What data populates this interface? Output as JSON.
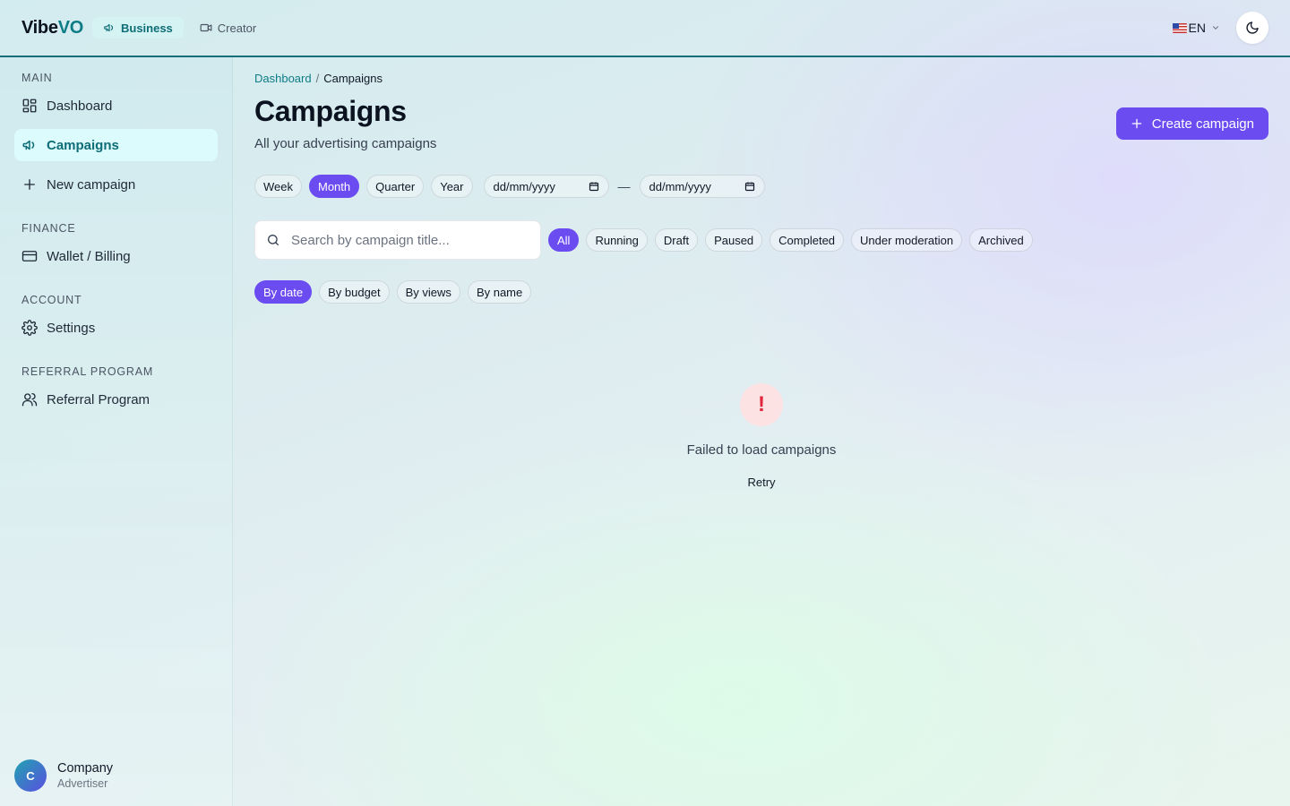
{
  "header": {
    "logo_main": "Vibe",
    "logo_accent": "VO",
    "modes": [
      {
        "label": "Business",
        "icon": "megaphone-icon",
        "active": true
      },
      {
        "label": "Creator",
        "icon": "video-icon",
        "active": false
      }
    ],
    "language": "EN",
    "theme_icon": "moon-icon"
  },
  "sidebar": {
    "sections": [
      {
        "label": "MAIN",
        "items": [
          {
            "label": "Dashboard",
            "icon": "grid-icon"
          },
          {
            "label": "Campaigns",
            "icon": "megaphone-icon",
            "active": true
          },
          {
            "label": "New campaign",
            "icon": "plus-icon"
          }
        ]
      },
      {
        "label": "FINANCE",
        "items": [
          {
            "label": "Wallet / Billing",
            "icon": "card-icon"
          }
        ]
      },
      {
        "label": "ACCOUNT",
        "items": [
          {
            "label": "Settings",
            "icon": "gear-icon"
          }
        ]
      },
      {
        "label": "REFERRAL PROGRAM",
        "items": [
          {
            "label": "Referral Program",
            "icon": "users-icon"
          }
        ]
      }
    ],
    "user": {
      "initial": "C",
      "name": "Company",
      "role": "Advertiser"
    }
  },
  "main": {
    "breadcrumb": {
      "parent": "Dashboard",
      "separator": "/",
      "current": "Campaigns"
    },
    "title": "Campaigns",
    "subtitle": "All your advertising campaigns",
    "create_button": "Create campaign",
    "periods": [
      "Week",
      "Month",
      "Quarter",
      "Year"
    ],
    "active_period": "Month",
    "date_from_placeholder": "dd/mm/yyyy",
    "date_to_placeholder": "dd/mm/yyyy",
    "date_separator": "—",
    "search_placeholder": "Search by campaign title...",
    "status_filters": [
      "All",
      "Running",
      "Draft",
      "Paused",
      "Completed",
      "Under moderation",
      "Archived"
    ],
    "active_status": "All",
    "sort_options": [
      "By date",
      "By budget",
      "By views",
      "By name"
    ],
    "active_sort": "By date",
    "error": {
      "symbol": "!",
      "message": "Failed to load campaigns",
      "retry": "Retry"
    }
  },
  "colors": {
    "accent": "#6a4cf0",
    "brand": "#0e7c86",
    "error": "#e0263a"
  }
}
